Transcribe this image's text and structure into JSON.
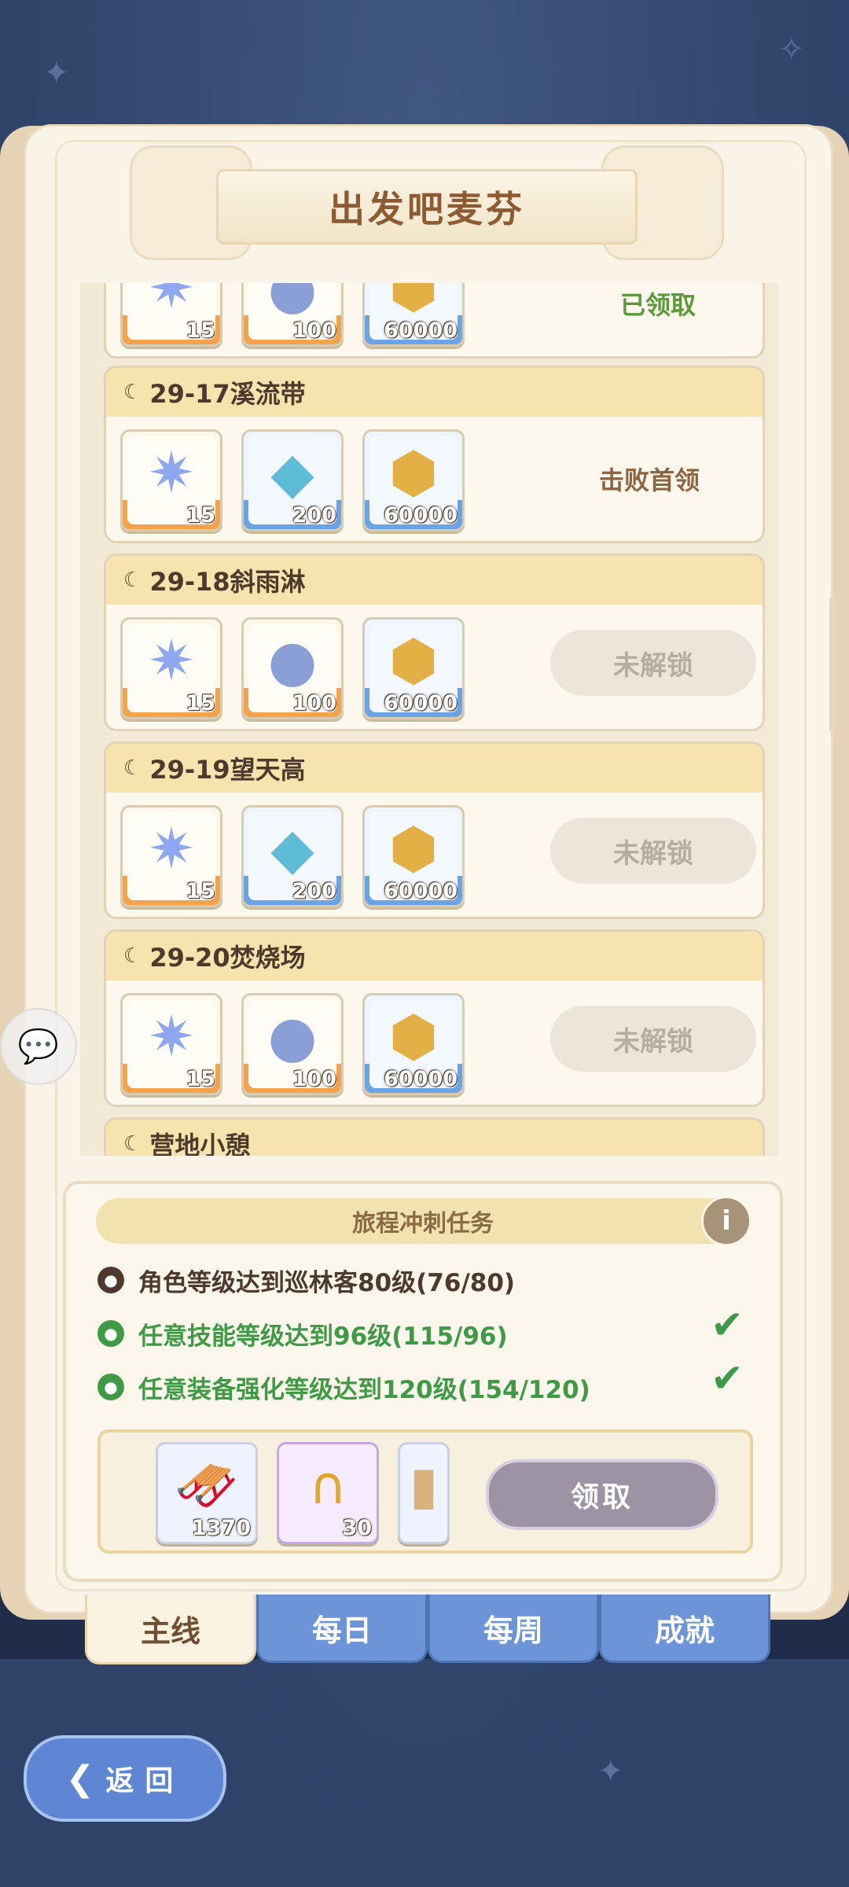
{
  "title": "出发吧麦芬",
  "stages": [
    {
      "name": "",
      "status": "已领取",
      "status_type": "claimed",
      "rewards": [
        {
          "icon": "star-crystal-icon",
          "qty": "15",
          "style": "orange"
        },
        {
          "icon": "orb-icon",
          "qty": "100",
          "style": "orange"
        },
        {
          "icon": "gold-coin-icon",
          "qty": "60000",
          "style": "blue"
        }
      ]
    },
    {
      "name": "29-17溪流带",
      "status": "击败首领",
      "status_type": "text",
      "rewards": [
        {
          "icon": "star-crystal-icon",
          "qty": "15",
          "style": "orange"
        },
        {
          "icon": "blue-crystal-icon",
          "qty": "200",
          "style": "blue"
        },
        {
          "icon": "gold-coin-icon",
          "qty": "60000",
          "style": "blue"
        }
      ]
    },
    {
      "name": "29-18斜雨淋",
      "status": "未解锁",
      "status_type": "locked",
      "rewards": [
        {
          "icon": "star-crystal-icon",
          "qty": "15",
          "style": "orange"
        },
        {
          "icon": "orb-icon",
          "qty": "100",
          "style": "orange"
        },
        {
          "icon": "gold-coin-icon",
          "qty": "60000",
          "style": "blue"
        }
      ]
    },
    {
      "name": "29-19望天高",
      "status": "未解锁",
      "status_type": "locked",
      "rewards": [
        {
          "icon": "star-crystal-icon",
          "qty": "15",
          "style": "orange"
        },
        {
          "icon": "blue-crystal-icon",
          "qty": "200",
          "style": "blue"
        },
        {
          "icon": "gold-coin-icon",
          "qty": "60000",
          "style": "blue"
        }
      ]
    },
    {
      "name": "29-20焚烧场",
      "status": "未解锁",
      "status_type": "locked",
      "rewards": [
        {
          "icon": "star-crystal-icon",
          "qty": "15",
          "style": "orange"
        },
        {
          "icon": "orb-icon",
          "qty": "100",
          "style": "orange"
        },
        {
          "icon": "gold-coin-icon",
          "qty": "60000",
          "style": "blue"
        }
      ]
    },
    {
      "name": "营地小憩",
      "status": "",
      "status_type": "none",
      "rewards": []
    }
  ],
  "task_panel": {
    "title": "旅程冲刺任务",
    "info_icon": "i",
    "tasks": [
      {
        "text": "角色等级达到巡林客80级(76/80)",
        "done": false,
        "color": "#4e3a2c"
      },
      {
        "text": "任意技能等级达到96级(115/96)",
        "done": true,
        "color": "#3e9a44"
      },
      {
        "text": "任意装备强化等级达到120级(154/120)",
        "done": true,
        "color": "#3e9a44"
      }
    ],
    "check_mark": "✔",
    "rewards": [
      {
        "icon": "saddle-icon",
        "qty": "1370"
      },
      {
        "icon": "horseshoe-icon",
        "qty": "30"
      },
      {
        "icon": "card-icon",
        "qty": ""
      }
    ],
    "claim_label": "领取"
  },
  "tabs": [
    {
      "label": "主线",
      "active": true
    },
    {
      "label": "每日",
      "active": false
    },
    {
      "label": "每周",
      "active": false
    },
    {
      "label": "成就",
      "active": false
    }
  ],
  "back_label": "返回"
}
